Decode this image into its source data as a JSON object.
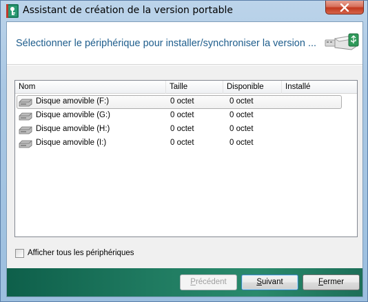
{
  "window": {
    "title": "Assistant de création de la version portable",
    "app_icon": "kaspersky-key-icon",
    "close_icon": "close-icon"
  },
  "header": {
    "title": "Sélectionner le périphérique pour installer/synchroniser la version ...",
    "icon": "usb-drive-icon"
  },
  "list": {
    "columns": [
      "Nom",
      "Taille",
      "Disponible",
      "Installé"
    ],
    "rows": [
      {
        "name": "Disque amovible (F:)",
        "size": "0 octet",
        "available": "0 octet",
        "installed": "",
        "selected": true
      },
      {
        "name": "Disque amovible (G:)",
        "size": "0 octet",
        "available": "0 octet",
        "installed": "",
        "selected": false
      },
      {
        "name": "Disque amovible (H:)",
        "size": "0 octet",
        "available": "0 octet",
        "installed": "",
        "selected": false
      },
      {
        "name": "Disque amovible (I:)",
        "size": "0 octet",
        "available": "0 octet",
        "installed": "",
        "selected": false
      }
    ],
    "row_icon": "removable-drive-icon"
  },
  "options": {
    "show_all_label": "Afficher tous les périphériques",
    "show_all_checked": false
  },
  "buttons": {
    "previous": {
      "first": "P",
      "rest": "récédent",
      "enabled": false
    },
    "next": {
      "first": "S",
      "rest": "uivant",
      "enabled": true
    },
    "close": {
      "first": "F",
      "rest": "ermer",
      "enabled": true
    }
  },
  "colors": {
    "header_title": "#1e5d8c",
    "footer": "#1f7a60"
  }
}
